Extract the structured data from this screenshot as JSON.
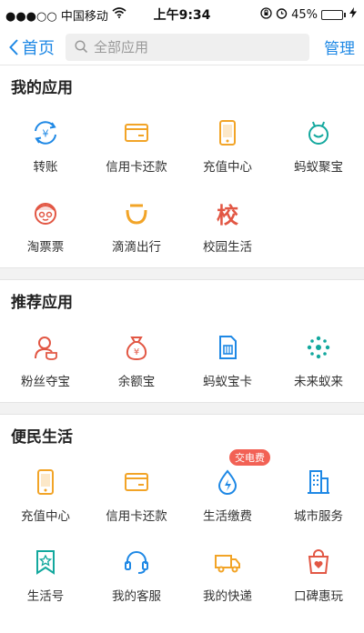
{
  "status_bar": {
    "carrier": "●●●○○ 中国移动",
    "time": "上午9:34",
    "battery_percent": "45%",
    "battery_level": 0.45
  },
  "nav": {
    "back_label": "首页",
    "search_placeholder": "全部应用",
    "manage_label": "管理"
  },
  "colors": {
    "accent": "#1e88e5",
    "orange": "#f2a427",
    "red": "#e25744",
    "teal": "#13a89e"
  },
  "sections": [
    {
      "title": "我的应用",
      "items": [
        {
          "label": "转账",
          "icon": "transfer-icon"
        },
        {
          "label": "信用卡还款",
          "icon": "credit-card-icon"
        },
        {
          "label": "充值中心",
          "icon": "phone-recharge-icon"
        },
        {
          "label": "蚂蚁聚宝",
          "icon": "ant-fortune-icon"
        },
        {
          "label": "淘票票",
          "icon": "ticket-mascot-icon"
        },
        {
          "label": "滴滴出行",
          "icon": "didi-icon"
        },
        {
          "label": "校园生活",
          "icon": "campus-icon",
          "glyph": "校"
        }
      ]
    },
    {
      "title": "推荐应用",
      "items": [
        {
          "label": "粉丝夺宝",
          "icon": "fans-treasure-icon"
        },
        {
          "label": "余额宝",
          "icon": "money-bag-icon"
        },
        {
          "label": "蚂蚁宝卡",
          "icon": "sim-card-icon"
        },
        {
          "label": "未来蚁来",
          "icon": "future-dots-icon"
        }
      ]
    },
    {
      "title": "便民生活",
      "items": [
        {
          "label": "充值中心",
          "icon": "phone-recharge-icon"
        },
        {
          "label": "信用卡还款",
          "icon": "credit-card-icon"
        },
        {
          "label": "生活缴费",
          "icon": "utility-drop-icon",
          "badge": "交电费"
        },
        {
          "label": "城市服务",
          "icon": "city-building-icon"
        },
        {
          "label": "生活号",
          "icon": "life-account-icon"
        },
        {
          "label": "我的客服",
          "icon": "customer-service-icon"
        },
        {
          "label": "我的快递",
          "icon": "delivery-truck-icon"
        },
        {
          "label": "口碑惠玩",
          "icon": "koubei-bag-icon"
        }
      ]
    }
  ]
}
